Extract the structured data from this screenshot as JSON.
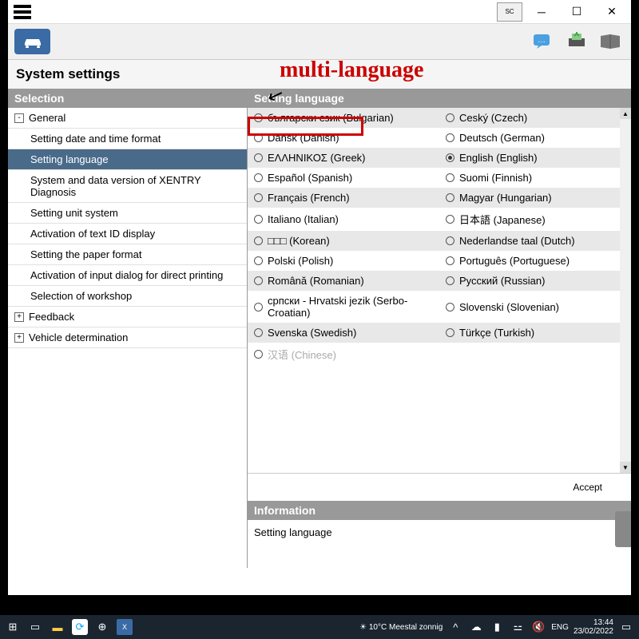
{
  "annotation": {
    "title": "multi-language"
  },
  "titlebar": {
    "badge": "SC"
  },
  "page": {
    "title": "System settings"
  },
  "sidebar": {
    "header": "Selection",
    "items": [
      {
        "label": "General",
        "level": 1,
        "expand": "-"
      },
      {
        "label": "Setting date and time format",
        "level": 2
      },
      {
        "label": "Setting language",
        "level": 2,
        "selected": true
      },
      {
        "label": "System and data version of XENTRY Diagnosis",
        "level": 2
      },
      {
        "label": "Setting unit system",
        "level": 2
      },
      {
        "label": "Activation of text ID display",
        "level": 2
      },
      {
        "label": "Setting the paper format",
        "level": 2
      },
      {
        "label": "Activation of input dialog for direct printing",
        "level": 2
      },
      {
        "label": "Selection of workshop",
        "level": 2
      },
      {
        "label": "Feedback",
        "level": 1,
        "expand": "+"
      },
      {
        "label": "Vehicle determination",
        "level": 1,
        "expand": "+"
      }
    ]
  },
  "main": {
    "header": "Setting language",
    "languages": [
      {
        "l": "български език (Bulgarian)",
        "r": "Ceský (Czech)"
      },
      {
        "l": "Dansk (Danish)",
        "r": "Deutsch (German)"
      },
      {
        "l": "ΕΛΛΗΝΙΚΟΣ (Greek)",
        "r": "English (English)",
        "r_checked": true
      },
      {
        "l": "Español (Spanish)",
        "r": "Suomi (Finnish)"
      },
      {
        "l": "Français (French)",
        "r": "Magyar (Hungarian)"
      },
      {
        "l": "Italiano (Italian)",
        "r": "日本語 (Japanese)"
      },
      {
        "l": "□□□ (Korean)",
        "r": "Nederlandse taal (Dutch)"
      },
      {
        "l": "Polski (Polish)",
        "r": "Português (Portuguese)"
      },
      {
        "l": "Română (Romanian)",
        "r": "Русский (Russian)"
      },
      {
        "l": "српски - Hrvatski jezik (Serbo-Croatian)",
        "r": "Slovenski (Slovenian)"
      },
      {
        "l": "Svenska (Swedish)",
        "r": "Türkçe (Turkish)"
      },
      {
        "l": "汉语 (Chinese)",
        "l_faded": true,
        "r": ""
      }
    ],
    "accept": "Accept",
    "info_header": "Information",
    "info_body": "Setting language"
  },
  "taskbar": {
    "weather": "10°C  Meestal zonnig",
    "lang": "ENG",
    "time": "13:44",
    "date": "23/02/2022"
  }
}
